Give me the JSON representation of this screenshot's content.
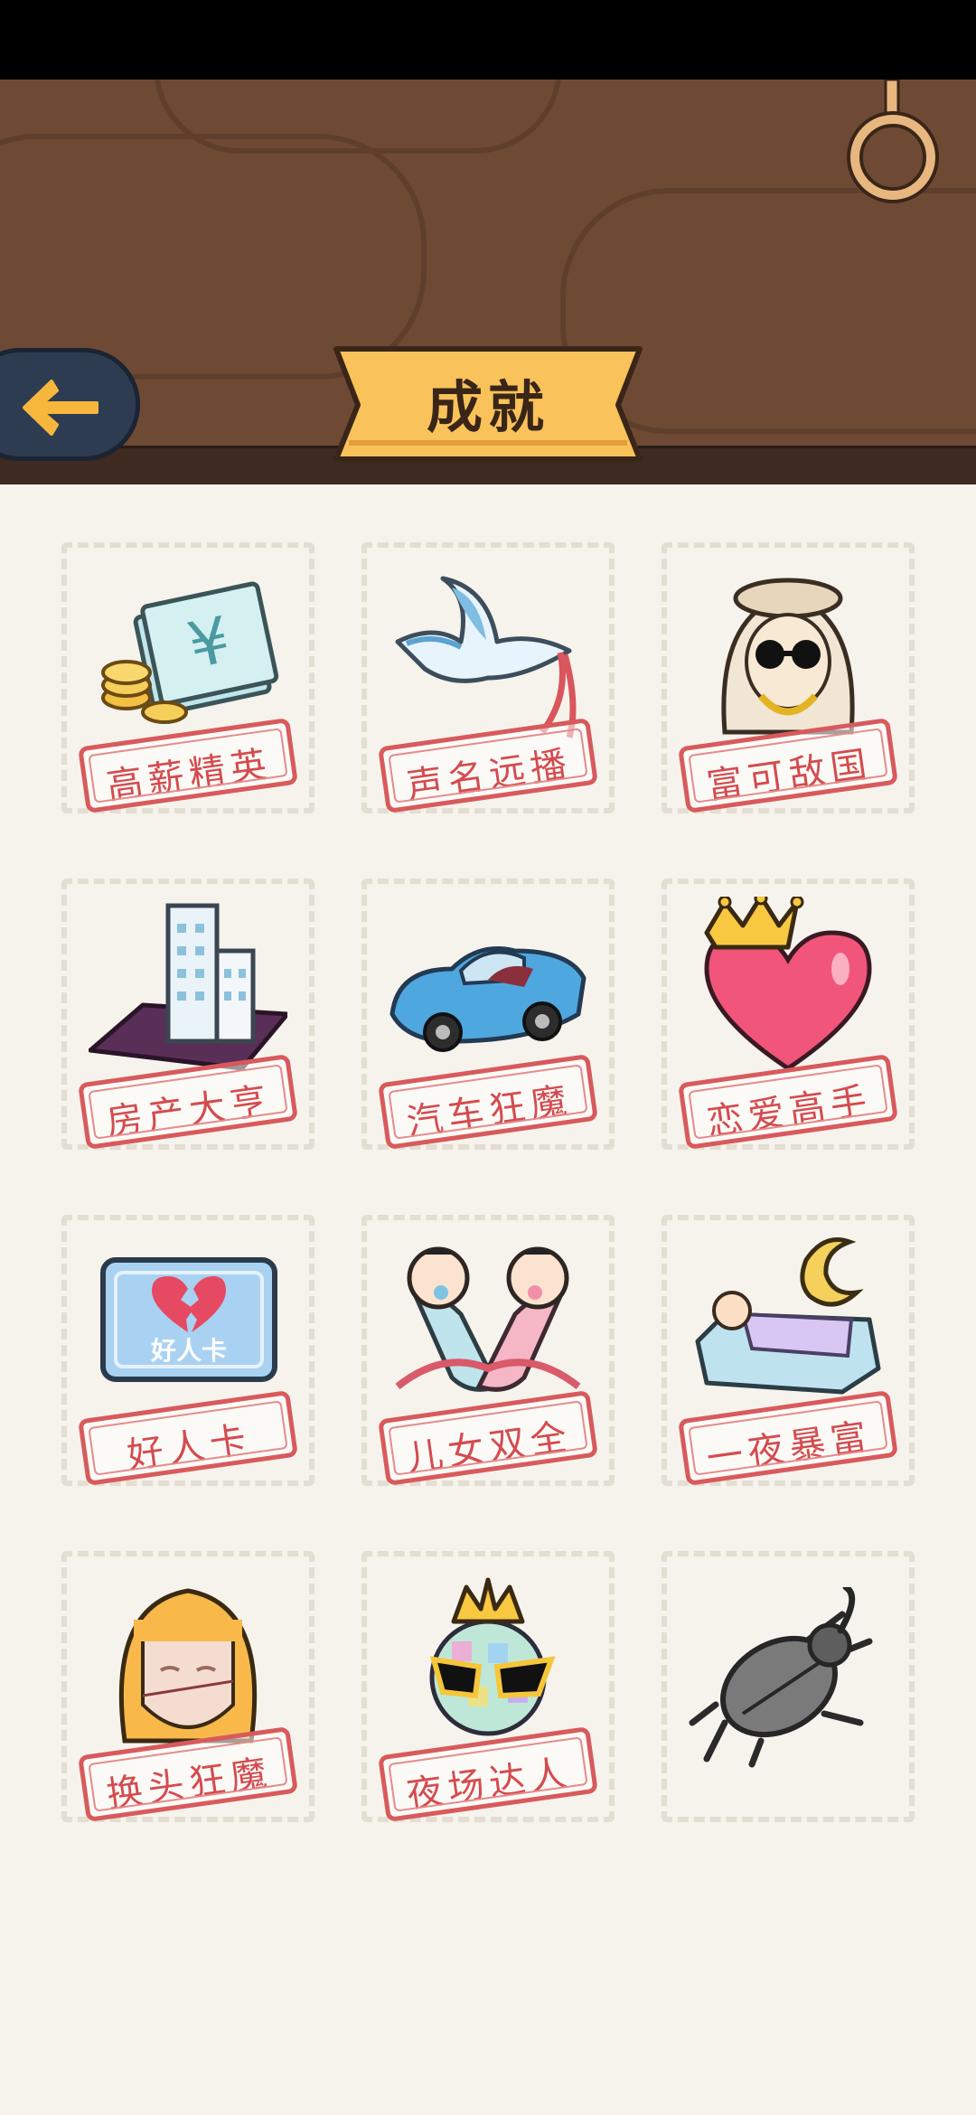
{
  "header": {
    "title": "成就",
    "back_icon": "arrow-left-icon",
    "ring_icon": "hanging-ring-icon"
  },
  "colors": {
    "stamp": "#d44b4f",
    "banner": "#f9c25a",
    "wood": "#6e4a35",
    "back_button": "#2e3c52"
  },
  "achievements": [
    {
      "label": "高薪精英",
      "icon": "money-stack-icon",
      "unlocked": true
    },
    {
      "label": "声名远播",
      "icon": "dove-icon",
      "unlocked": true
    },
    {
      "label": "富可敌国",
      "icon": "rich-man-icon",
      "unlocked": true
    },
    {
      "label": "房产大亨",
      "icon": "property-certificate-icon",
      "unlocked": true
    },
    {
      "label": "汽车狂魔",
      "icon": "car-icon",
      "unlocked": true
    },
    {
      "label": "恋爱高手",
      "icon": "crowned-heart-icon",
      "unlocked": true
    },
    {
      "label": "好人卡",
      "icon": "good-person-card-icon",
      "unlocked": true,
      "card_text": "好人卡"
    },
    {
      "label": "儿女双全",
      "icon": "twin-babies-icon",
      "unlocked": true
    },
    {
      "label": "一夜暴富",
      "icon": "money-bed-icon",
      "unlocked": true
    },
    {
      "label": "换头狂魔",
      "icon": "stitched-head-icon",
      "unlocked": true
    },
    {
      "label": "夜场达人",
      "icon": "disco-ball-icon",
      "unlocked": true
    },
    {
      "label": "",
      "icon": "beetle-icon",
      "unlocked": false
    }
  ]
}
